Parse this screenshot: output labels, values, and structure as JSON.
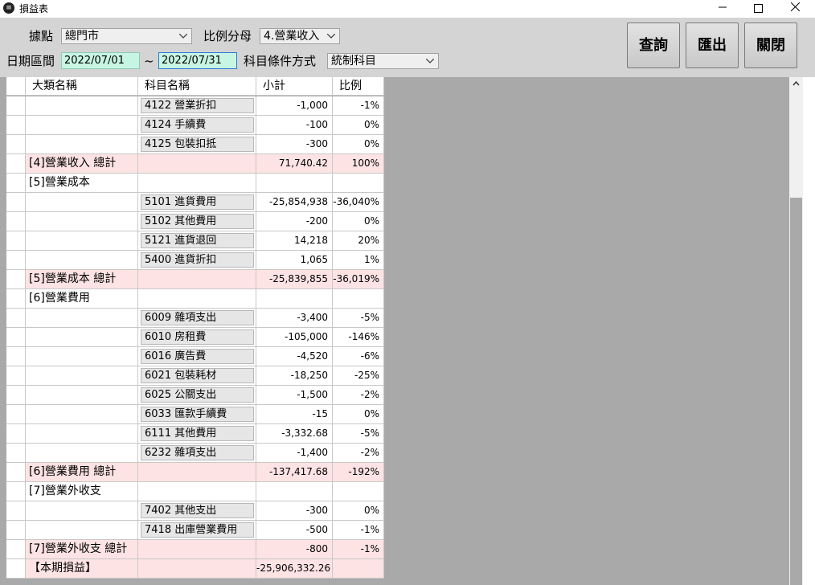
{
  "window": {
    "title": "損益表",
    "icon_glyph": "≡"
  },
  "toolbar": {
    "location_label": "據點",
    "location_value": "總門市",
    "ratio_label": "比例分母",
    "ratio_value": "4.營業收入",
    "date_label": "日期區間",
    "date_from": "2022/07/01",
    "date_sep": "~",
    "date_to": "2022/07/31",
    "cond_label": "科目條件方式",
    "cond_value": "統制科目",
    "query_label": "查詢",
    "export_label": "匯出",
    "close_label": "關閉"
  },
  "colors": {
    "date_input_bg": "#c7f5e4",
    "total_row_bg": "#fde3e3",
    "grid_bg": "#a9a9a9",
    "toolbar_bg": "#d4d4d4"
  },
  "table": {
    "headers": [
      "大類名稱",
      "科目名稱",
      "小計",
      "比例"
    ],
    "rows": [
      {
        "category": "",
        "account": "4122 營業折扣",
        "subtotal": "-1,000",
        "ratio": "-1%",
        "total": false
      },
      {
        "category": "",
        "account": "4124 手續費",
        "subtotal": "-100",
        "ratio": "0%",
        "total": false
      },
      {
        "category": "",
        "account": "4125 包裝扣抵",
        "subtotal": "-300",
        "ratio": "0%",
        "total": false
      },
      {
        "category": "[4]營業收入 總計",
        "account": "",
        "subtotal": "71,740.42",
        "ratio": "100%",
        "total": true
      },
      {
        "category": "[5]營業成本",
        "account": "",
        "subtotal": "",
        "ratio": "",
        "total": false
      },
      {
        "category": "",
        "account": "5101 進貨費用",
        "subtotal": "-25,854,938",
        "ratio": "-36,040%",
        "total": false
      },
      {
        "category": "",
        "account": "5102 其他費用",
        "subtotal": "-200",
        "ratio": "0%",
        "total": false
      },
      {
        "category": "",
        "account": "5121 進貨退回",
        "subtotal": "14,218",
        "ratio": "20%",
        "total": false
      },
      {
        "category": "",
        "account": "5400 進貨折扣",
        "subtotal": "1,065",
        "ratio": "1%",
        "total": false
      },
      {
        "category": "[5]營業成本 總計",
        "account": "",
        "subtotal": "-25,839,855",
        "ratio": "-36,019%",
        "total": true
      },
      {
        "category": "[6]營業費用",
        "account": "",
        "subtotal": "",
        "ratio": "",
        "total": false
      },
      {
        "category": "",
        "account": "6009 雜項支出",
        "subtotal": "-3,400",
        "ratio": "-5%",
        "total": false
      },
      {
        "category": "",
        "account": "6010 房租費",
        "subtotal": "-105,000",
        "ratio": "-146%",
        "total": false
      },
      {
        "category": "",
        "account": "6016 廣告費",
        "subtotal": "-4,520",
        "ratio": "-6%",
        "total": false
      },
      {
        "category": "",
        "account": "6021 包裝耗材",
        "subtotal": "-18,250",
        "ratio": "-25%",
        "total": false
      },
      {
        "category": "",
        "account": "6025 公關支出",
        "subtotal": "-1,500",
        "ratio": "-2%",
        "total": false
      },
      {
        "category": "",
        "account": "6033 匯款手續費",
        "subtotal": "-15",
        "ratio": "0%",
        "total": false
      },
      {
        "category": "",
        "account": "6111 其他費用",
        "subtotal": "-3,332.68",
        "ratio": "-5%",
        "total": false
      },
      {
        "category": "",
        "account": "6232 雜項支出",
        "subtotal": "-1,400",
        "ratio": "-2%",
        "total": false
      },
      {
        "category": "[6]營業費用 總計",
        "account": "",
        "subtotal": "-137,417.68",
        "ratio": "-192%",
        "total": true
      },
      {
        "category": "[7]營業外收支",
        "account": "",
        "subtotal": "",
        "ratio": "",
        "total": false
      },
      {
        "category": "",
        "account": "7402 其他支出",
        "subtotal": "-300",
        "ratio": "0%",
        "total": false
      },
      {
        "category": "",
        "account": "7418 出庫營業費用",
        "subtotal": "-500",
        "ratio": "-1%",
        "total": false
      },
      {
        "category": "[7]營業外收支 總計",
        "account": "",
        "subtotal": "-800",
        "ratio": "-1%",
        "total": true
      },
      {
        "category": "【本期損益】",
        "account": "",
        "subtotal": "-25,906,332.26",
        "ratio": "",
        "total": true
      }
    ]
  }
}
